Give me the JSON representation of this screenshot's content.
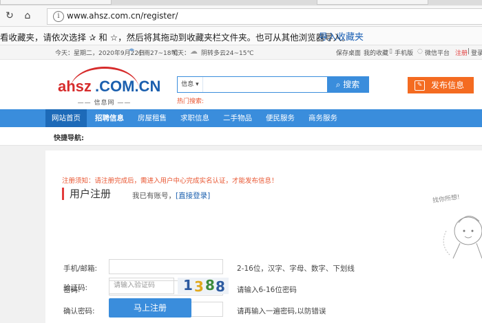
{
  "browser": {
    "url": "www.ahsz.com.cn/register/",
    "favbar_message": "看收藏夹，请依次选择 ✰ 和 ☆，然后将其拖动到收藏夹栏文件夹。也可从其他浏览器导入。",
    "import_link": "导入收藏夹"
  },
  "topbar": {
    "today": "今天：星期二，2020年9月22日",
    "weather_today": "小雨27~18℃",
    "tomorrow_label": "明天：",
    "weather_tomorrow": "阴转多云24~15℃",
    "links": [
      "保存桌面",
      "我的收藏",
      "手机版",
      "微信平台",
      "注册",
      "登录"
    ]
  },
  "header": {
    "logo_left": "ahsz",
    "logo_right": ".COM.CN",
    "logo_sub": "—— 信息网 ——",
    "search_category": "信息",
    "search_button": "搜索",
    "hot_search": "热门搜索:",
    "publish_button": "发布信息"
  },
  "nav": {
    "items": [
      "网站首页",
      "招聘信息",
      "房屋租售",
      "求职信息",
      "二手物品",
      "便民服务",
      "商务服务"
    ]
  },
  "quick_nav": "快捷导航:",
  "register": {
    "notice": "注册须知：请注册完成后，需进入用户中心完成实名认证，才能发布信息！",
    "title": "用户注册",
    "have_account": "我已有账号，",
    "login_link": "[直接登录]",
    "fields": [
      {
        "label": "手机/邮箱:",
        "hint": "2-16位，汉字、字母、数字、下划线"
      },
      {
        "label": "密码:",
        "hint": "请输入6-16位密码"
      },
      {
        "label": "确认密码:",
        "hint": "请再输入一遍密码,以防错误"
      }
    ],
    "captcha_label": "验证码:",
    "captcha_placeholder": "请输入验证码",
    "captcha_digits": [
      "1",
      "3",
      "8",
      "8"
    ],
    "submit": "马上注册",
    "cartoon_text": "找你所想!"
  }
}
